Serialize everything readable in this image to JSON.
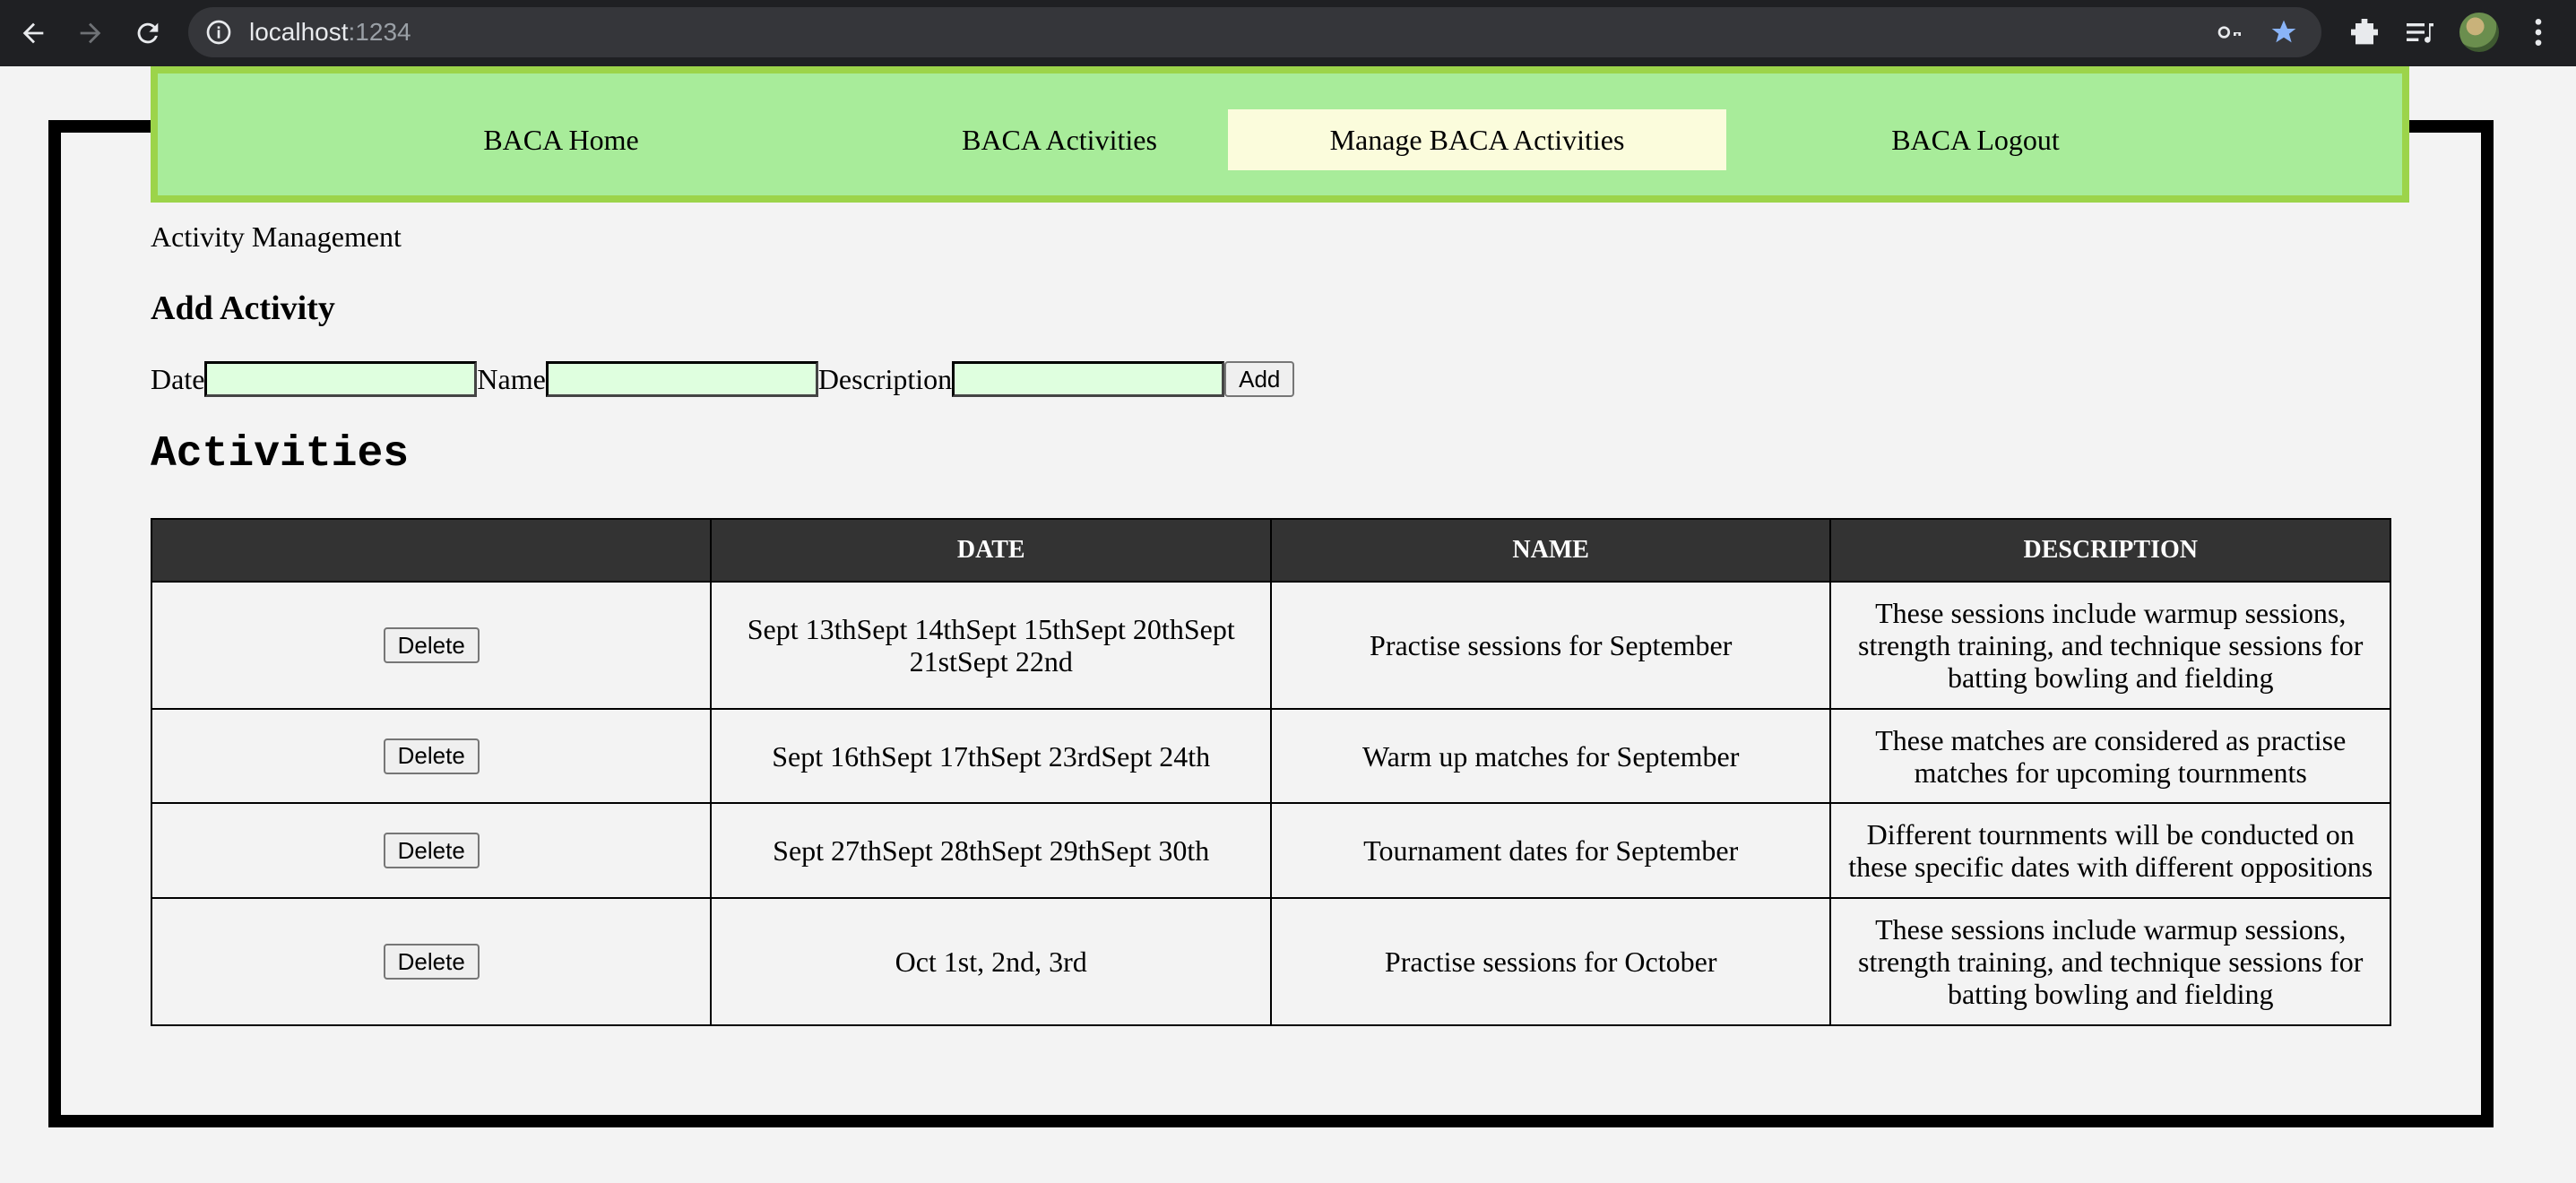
{
  "browser": {
    "url_host": "localhost",
    "url_port": ":1234"
  },
  "nav": {
    "items": [
      {
        "label": "BACA Home"
      },
      {
        "label": "BACA Activities"
      },
      {
        "label": "Manage BACA Activities",
        "active": true
      },
      {
        "label": "BACA Logout"
      }
    ]
  },
  "page": {
    "subtitle": "Activity Management",
    "add_title": "Add Activity",
    "form": {
      "date_label": "Date",
      "name_label": "Name",
      "description_label": "Description",
      "date_value": "",
      "name_value": "",
      "description_value": "",
      "add_button": "Add"
    },
    "activities_title": "Activities"
  },
  "table": {
    "headers": [
      "",
      "DATE",
      "NAME",
      "DESCRIPTION"
    ],
    "delete_label": "Delete",
    "rows": [
      {
        "date": "Sept 13thSept 14thSept 15thSept 20thSept 21stSept 22nd",
        "name": "Practise sessions for September",
        "description": "These sessions include warmup sessions, strength training, and technique sessions for batting bowling and fielding"
      },
      {
        "date": "Sept 16thSept 17thSept 23rdSept 24th",
        "name": "Warm up matches for September",
        "description": "These matches are considered as practise matches for upcoming tournments"
      },
      {
        "date": "Sept 27thSept 28thSept 29thSept 30th",
        "name": "Tournament dates for September",
        "description": "Different tournments will be conducted on these specific dates with different oppositions"
      },
      {
        "date": "Oct 1st, 2nd, 3rd",
        "name": "Practise sessions for October",
        "description": "These sessions include warmup sessions, strength training, and technique sessions for batting bowling and fielding"
      }
    ]
  },
  "colors": {
    "nav_bg": "#a8ec9a",
    "nav_border": "#9cd44a",
    "nav_active": "#fbfcdc",
    "input_bg": "#dfffdf",
    "table_header_bg": "#333333"
  }
}
